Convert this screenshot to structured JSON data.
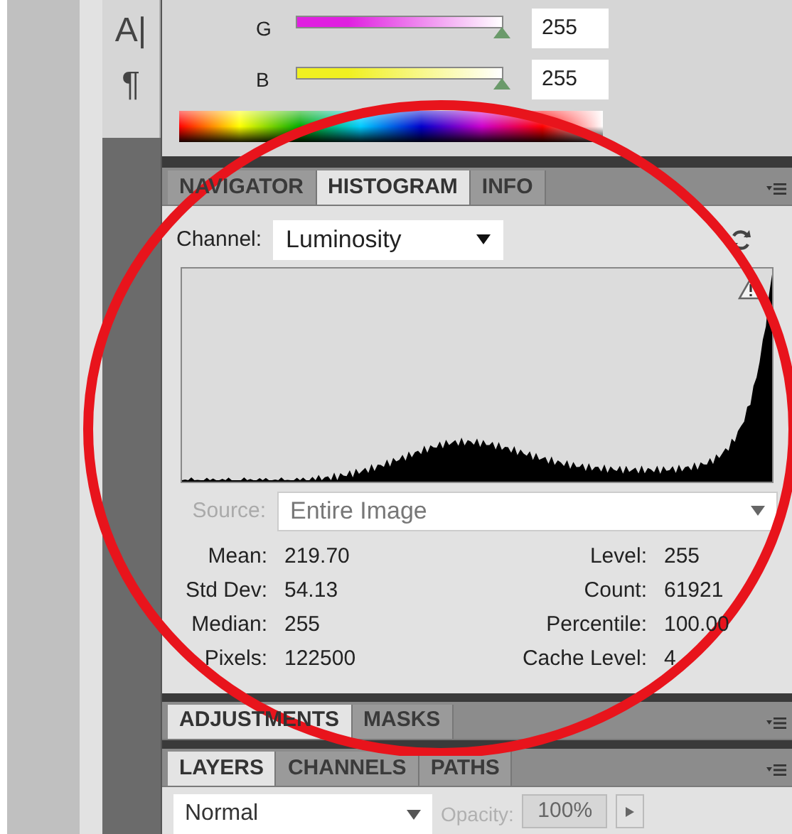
{
  "tools": [
    {
      "glyph": "A|"
    },
    {
      "glyph": "¶"
    }
  ],
  "color_sliders": [
    {
      "label": "G",
      "value": "255",
      "level": 1,
      "color": "#e020e0"
    },
    {
      "label": "B",
      "value": "255",
      "level": 1,
      "color": "#f0f020"
    }
  ],
  "histogram_tabs": [
    {
      "label": "NAVIGATOR",
      "selected": false
    },
    {
      "label": "HISTOGRAM",
      "selected": true
    },
    {
      "label": "INFO",
      "selected": false
    }
  ],
  "histogram": {
    "channel_label": "Channel:",
    "channel_value": "Luminosity",
    "source_label": "Source:",
    "source_value": "Entire Image",
    "source_disabled": true,
    "stats_left": [
      {
        "label": "Mean:",
        "value": "219.70"
      },
      {
        "label": "Std Dev:",
        "value": "54.13"
      },
      {
        "label": "Median:",
        "value": "255"
      },
      {
        "label": "Pixels:",
        "value": "122500"
      }
    ],
    "stats_right": [
      {
        "label": "Level:",
        "value": "255"
      },
      {
        "label": "Count:",
        "value": "61921"
      },
      {
        "label": "Percentile:",
        "value": "100.00"
      },
      {
        "label": "Cache Level:",
        "value": "4"
      }
    ]
  },
  "adjustment_tabs": [
    {
      "label": "ADJUSTMENTS",
      "selected": true
    },
    {
      "label": "MASKS",
      "selected": false
    }
  ],
  "layer_tabs": [
    {
      "label": "LAYERS",
      "selected": true
    },
    {
      "label": "CHANNELS",
      "selected": false
    },
    {
      "label": "PATHS",
      "selected": false
    }
  ],
  "layers": {
    "blend_mode": "Normal",
    "opacity_label": "Opacity:",
    "opacity_value": "100%",
    "opacity_disabled": true
  }
}
